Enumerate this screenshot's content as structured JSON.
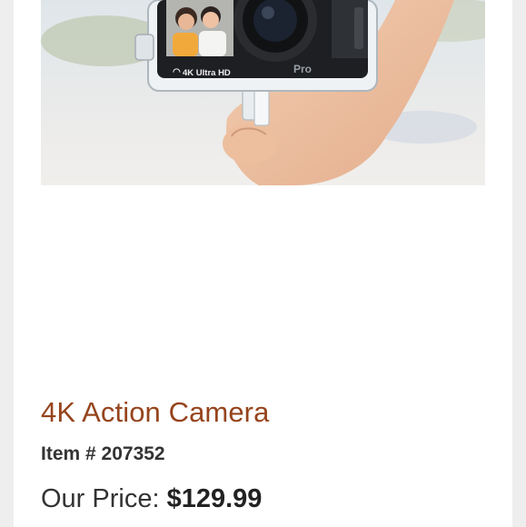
{
  "product": {
    "image_alt": "4K Action Camera in waterproof case held in hand",
    "camera_badge": "4K Ultra HD",
    "camera_brand": "Pro",
    "title": "4K Action Camera",
    "item_number": "Item # 207352",
    "price_label": "Our Price: ",
    "price_value": "$129.99"
  },
  "colors": {
    "page_background": "#eeeeee",
    "card_background": "#ffffff",
    "title_color": "#96441d",
    "text_color": "#333333"
  }
}
